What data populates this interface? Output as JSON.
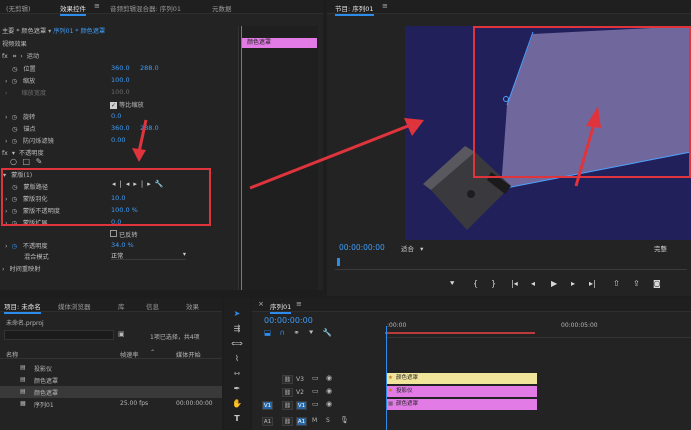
{
  "effect_controls": {
    "tabs": [
      "(无剪辑)",
      "效果控件",
      "音频剪辑混合器: 序列01",
      "元数据"
    ],
    "breadcrumb": "主要 * 颜色遮罩",
    "breadcrumb_seq": "序列01 * 颜色遮罩",
    "video_effects": "视频效果",
    "timeline_clip": "颜色遮罩",
    "motion": "运动",
    "position_label": "位置",
    "position_x": "360.0",
    "position_y": "288.0",
    "scale_label": "缩放",
    "scale_value": "100.0",
    "scale_width_label": "缩放宽度",
    "scale_width_value": "100.0",
    "uniform_scale": "等比缩放",
    "rotation_label": "旋转",
    "rotation_value": "0.0",
    "anchor_label": "锚点",
    "anchor_x": "360.0",
    "anchor_y": "288.0",
    "antiflicker_label": "防闪烁滤镜",
    "antiflicker_value": "0.00",
    "opacity_section": "不透明度",
    "mask_title": "蒙版(1)",
    "mask_path": "蒙版路径",
    "mask_feather": "蒙版羽化",
    "mask_feather_value": "10.0",
    "mask_opacity": "蒙版不透明度",
    "mask_opacity_value": "100.0 %",
    "mask_expansion": "蒙版扩展",
    "mask_expansion_value": "0.0",
    "inverted": "已反转",
    "opacity_label": "不透明度",
    "opacity_value": "34.0 %",
    "blend_label": "混合模式",
    "blend_value": "正常",
    "time_remap": "时间重映射"
  },
  "program_monitor": {
    "title": "节目: 序列01",
    "timecode": "00:00:00:00",
    "fit": "适合",
    "quality": "完整"
  },
  "project_panel": {
    "tabs": [
      "项目: 未命名",
      "媒体浏览器",
      "库",
      "信息",
      "效果"
    ],
    "project_file": "未命名.prproj",
    "selection_info": "1项已选择，共4项",
    "col_name": "名称",
    "col_fps": "帧速率",
    "col_start": "媒体开始",
    "items": [
      {
        "name": "投影仪",
        "fps": "",
        "start": ""
      },
      {
        "name": "颜色遮罩",
        "fps": "",
        "start": ""
      },
      {
        "name": "颜色遮罩",
        "fps": "",
        "start": ""
      },
      {
        "name": "序列01",
        "fps": "25.00 fps",
        "start": "00:00:00:00"
      }
    ]
  },
  "timeline": {
    "title": "序列01",
    "timecode": "00:00:00:00",
    "ruler_start": ":00:00",
    "ruler_mid": "00:00:05:00",
    "tracks": [
      "V3",
      "V2",
      "V1",
      "A1"
    ],
    "clips": {
      "v3": "颜色遮罩",
      "v2": "投影仪",
      "v1": "颜色遮罩"
    },
    "v1_source": "V1",
    "a1_source": "A1"
  },
  "colors": {
    "accent_blue": "#2d8ceb",
    "annotation_red": "#e0343d",
    "clip_pink": "#e27be6",
    "clip_yellow": "#f1e49b"
  }
}
